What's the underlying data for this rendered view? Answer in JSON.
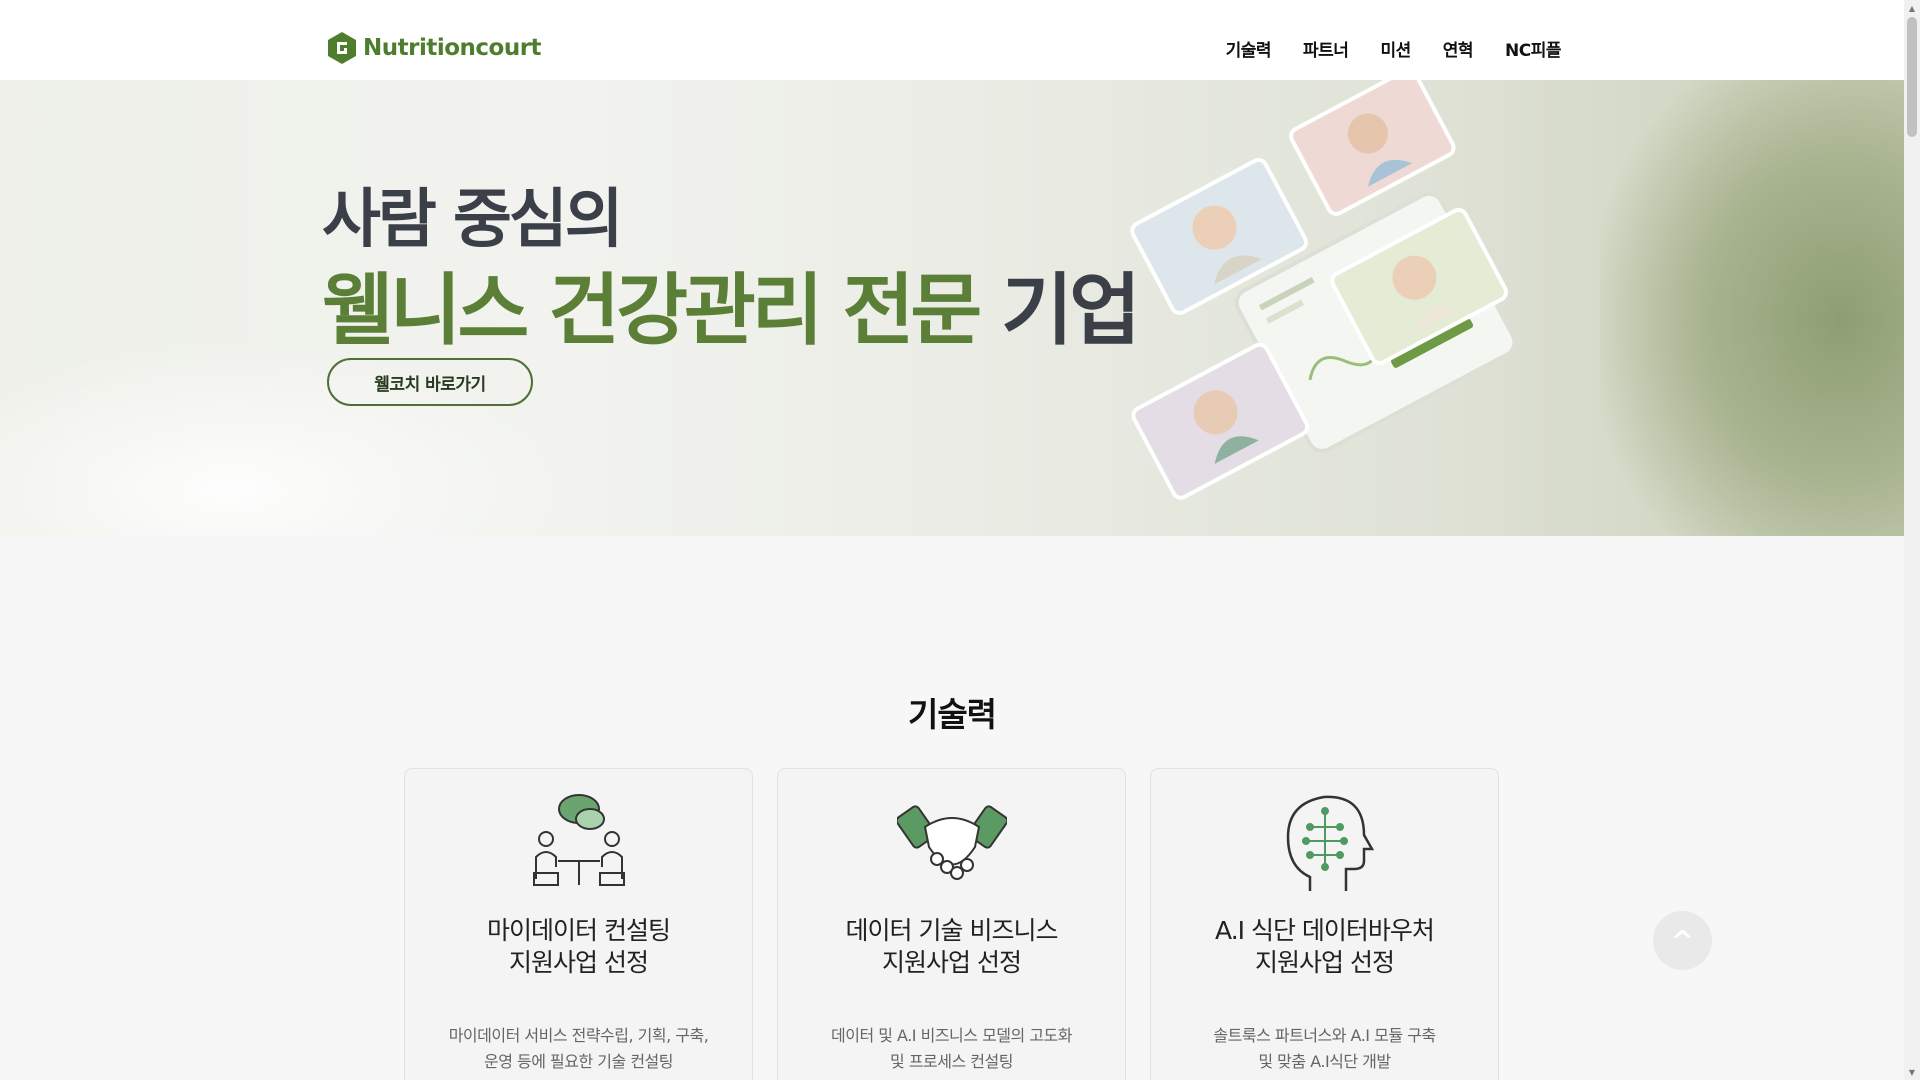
{
  "header": {
    "logo_text": "Nutritioncourt",
    "nav": [
      "기술력",
      "파트너",
      "미션",
      "연혁",
      "NC피플"
    ]
  },
  "hero": {
    "line1": "사람 중심의",
    "line2_green": "웰니스 건강관리 전문",
    "line2_dark": " 기업",
    "button_label": "웰코치 바로가기"
  },
  "section": {
    "title": "기술력",
    "cards": [
      {
        "icon": "consulting-people-icon",
        "title_line1": "마이데이터 컨설팅",
        "title_line2": "지원사업 선정",
        "desc_line1": "마이데이터 서비스 전략수립, 기획, 구축,",
        "desc_line2": "운영 등에 필요한 기술 컨설팅"
      },
      {
        "icon": "handshake-icon",
        "title_line1": "데이터 기술 비즈니스",
        "title_line2": "지원사업 선정",
        "desc_line1": "데이터 및 A.I 비즈니스 모델의 고도화",
        "desc_line2": "및 프로세스 컨설팅"
      },
      {
        "icon": "ai-head-icon",
        "title_line1": "A.I 식단 데이터바우처",
        "title_line2": "지원사업 선정",
        "desc_line1": "솔트룩스 파트너스와 A.I 모듈 구축",
        "desc_line2": "및 맞춤 A.I식단 개발"
      }
    ]
  },
  "top_button": "^",
  "colors": {
    "brand_green": "#5b7f36",
    "dark_text": "#3a3f48",
    "page_bg": "#f7f7f7"
  }
}
